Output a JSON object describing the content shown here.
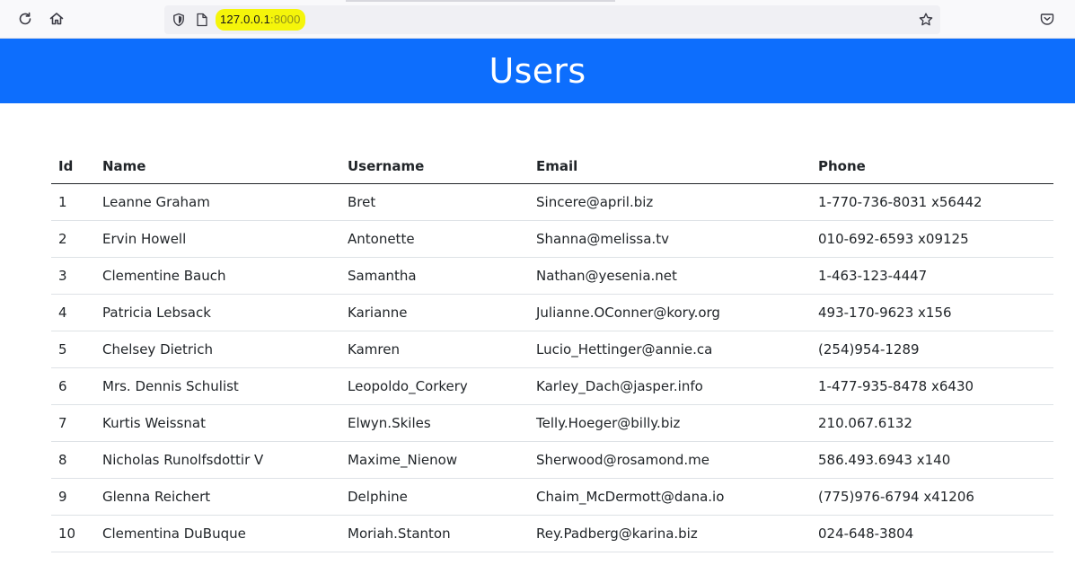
{
  "browser": {
    "url_host": "127.0.0.1",
    "url_port": ":8000",
    "icons": [
      "reload-icon",
      "home-icon",
      "shield-icon",
      "page-icon",
      "star-icon",
      "pocket-icon"
    ]
  },
  "page": {
    "title": "Users",
    "header_color": "#0d6efd"
  },
  "table": {
    "headers": {
      "id": "Id",
      "name": "Name",
      "username": "Username",
      "email": "Email",
      "phone": "Phone"
    },
    "rows": [
      {
        "id": "1",
        "name": "Leanne Graham",
        "username": "Bret",
        "email": "Sincere@april.biz",
        "phone": "1-770-736-8031 x56442"
      },
      {
        "id": "2",
        "name": "Ervin Howell",
        "username": "Antonette",
        "email": "Shanna@melissa.tv",
        "phone": "010-692-6593 x09125"
      },
      {
        "id": "3",
        "name": "Clementine Bauch",
        "username": "Samantha",
        "email": "Nathan@yesenia.net",
        "phone": "1-463-123-4447"
      },
      {
        "id": "4",
        "name": "Patricia Lebsack",
        "username": "Karianne",
        "email": "Julianne.OConner@kory.org",
        "phone": "493-170-9623 x156"
      },
      {
        "id": "5",
        "name": "Chelsey Dietrich",
        "username": "Kamren",
        "email": "Lucio_Hettinger@annie.ca",
        "phone": "(254)954-1289"
      },
      {
        "id": "6",
        "name": "Mrs. Dennis Schulist",
        "username": "Leopoldo_Corkery",
        "email": "Karley_Dach@jasper.info",
        "phone": "1-477-935-8478 x6430"
      },
      {
        "id": "7",
        "name": "Kurtis Weissnat",
        "username": "Elwyn.Skiles",
        "email": "Telly.Hoeger@billy.biz",
        "phone": "210.067.6132"
      },
      {
        "id": "8",
        "name": "Nicholas Runolfsdottir V",
        "username": "Maxime_Nienow",
        "email": "Sherwood@rosamond.me",
        "phone": "586.493.6943 x140"
      },
      {
        "id": "9",
        "name": "Glenna Reichert",
        "username": "Delphine",
        "email": "Chaim_McDermott@dana.io",
        "phone": "(775)976-6794 x41206"
      },
      {
        "id": "10",
        "name": "Clementina DuBuque",
        "username": "Moriah.Stanton",
        "email": "Rey.Padberg@karina.biz",
        "phone": "024-648-3804"
      }
    ]
  }
}
